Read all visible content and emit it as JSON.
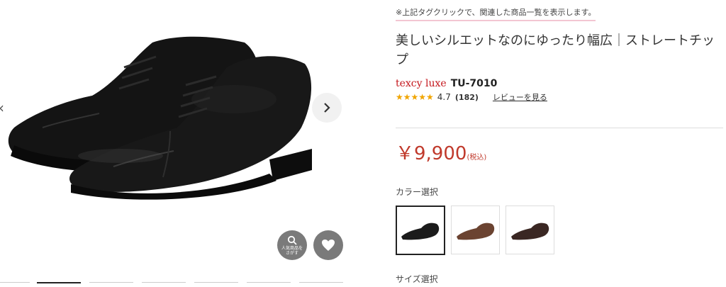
{
  "gallery": {
    "search_label_line1": "人気商品を",
    "search_label_line2": "さがす",
    "prev_icon": "chevron-left-icon",
    "next_icon": "chevron-right-icon",
    "fav_icon": "heart-icon"
  },
  "product": {
    "tag_note": "※上記タグクリックで、関連した商品一覧を表示します。",
    "title": "美しいシルエットなのにゆったり幅広｜ストレートチップ",
    "brand": "texcy luxe",
    "model": "TU-7010",
    "stars": "★★★★★",
    "rating": "4.7",
    "review_count": "(182)",
    "review_link": "レビューを見る",
    "price": "￥9,900",
    "tax_note": "(税込)",
    "color_label": "カラー選択",
    "size_label": "サイズ選択"
  },
  "colors": {
    "accent_red": "#c4161c",
    "price_red": "#c0392b",
    "star": "#f0a500",
    "swatch_colors": [
      "#1b1b1b",
      "#6b4331",
      "#3a2723"
    ]
  }
}
